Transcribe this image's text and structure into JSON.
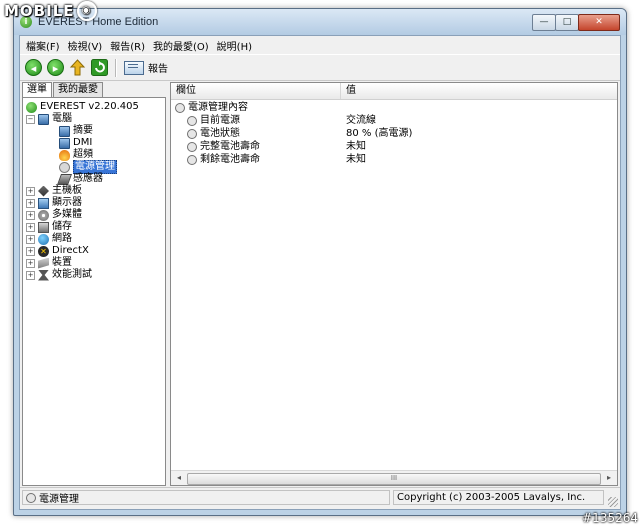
{
  "watermark": {
    "text": "MOBILE",
    "id_tag": "#135264"
  },
  "window": {
    "title": "EVEREST Home Edition",
    "buttons": {
      "minimize": "—",
      "maximize": "□",
      "close": "✕"
    }
  },
  "menu": [
    "檔案(F)",
    "檢視(V)",
    "報告(R)",
    "我的最愛(O)",
    "說明(H)"
  ],
  "toolbar": {
    "report_label": "報告"
  },
  "tabs": [
    "選單",
    "我的最愛"
  ],
  "tree": {
    "root": "EVEREST v2.20.405",
    "computer": "電腦",
    "children": [
      "摘要",
      "DMI",
      "超頻",
      "電源管理",
      "感應器"
    ],
    "selected": "電源管理",
    "categories": [
      "主機板",
      "顯示器",
      "多媒體",
      "儲存",
      "網路",
      "DirectX",
      "裝置",
      "效能測試"
    ]
  },
  "columns": {
    "field": "欄位",
    "value": "值"
  },
  "properties": {
    "group": "電源管理內容",
    "rows": [
      {
        "field": "目前電源",
        "value": "交流線"
      },
      {
        "field": "電池狀態",
        "value": "80 % (高電源)"
      },
      {
        "field": "完整電池壽命",
        "value": "未知"
      },
      {
        "field": "剩餘電池壽命",
        "value": "未知"
      }
    ]
  },
  "scrollbar": {
    "thumb": "III",
    "left": "◂",
    "right": "▸"
  },
  "status": {
    "left": "電源管理",
    "right": "Copyright (c) 2003-2005 Lavalys, Inc."
  }
}
